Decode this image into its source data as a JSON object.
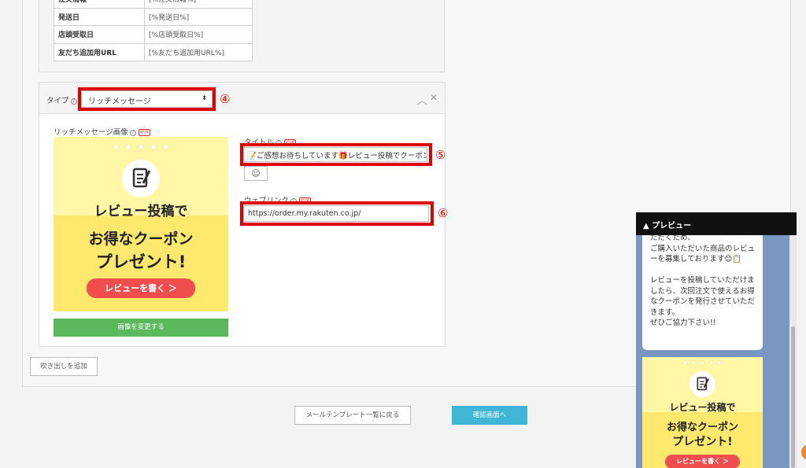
{
  "variables": [
    {
      "key": "注文情報",
      "value": "[%注文情報%]"
    },
    {
      "key": "発送日",
      "value": "[%発送日%]"
    },
    {
      "key": "店頭受取日",
      "value": "[%店頭受取日%]"
    },
    {
      "key": "友だち追加用URL",
      "value": "[%友だち追加用URL%]"
    }
  ],
  "message": {
    "type_label": "タイプ",
    "type_value": "リッチメッセージ",
    "marker_type": "④",
    "image_label": "リッチメッセージ画像",
    "required": "必須",
    "title_label": "タイトル",
    "title_value": "📝ご感想お待ちしています🎁レビュー投稿でクーポンプ",
    "marker_title": "⑤",
    "emoji_button": "☺",
    "weblink_label": "ウェブリンク",
    "weblink_value": "https://order.my.rakuten.co.jp/",
    "marker_weblink": "⑥",
    "change_image_button": "画像を変更する"
  },
  "coupon": {
    "line1": "レビュー投稿で",
    "line2": "お得なクーポン",
    "line3": "プレゼント!",
    "button": "レビューを書く ＞",
    "stars": "★ ★ ★ ★ ★"
  },
  "add_bubble_button": "吹き出しを追加",
  "footer": {
    "back_button": "メールテンプレート一覧に戻る",
    "confirm_button": "確認画面へ"
  },
  "preview": {
    "title": "▲ プレビュー",
    "bubble_text": "ただくため、\nご購入いただいた商品のレビューを募集しております😊📋\n\nレビューを投稿していただけましたら、次回注文で使えるお得なクーポンを発行させていただきます。\nぜひご協力下さい!!"
  },
  "colors": {
    "highlight_red": "#e00000",
    "green_button": "#5cb85c",
    "blue_button": "#3fb6d6",
    "preview_bg": "#7a97c2",
    "coupon_yellow": "#fff6a6",
    "coupon_red_button": "#f04e4e"
  }
}
